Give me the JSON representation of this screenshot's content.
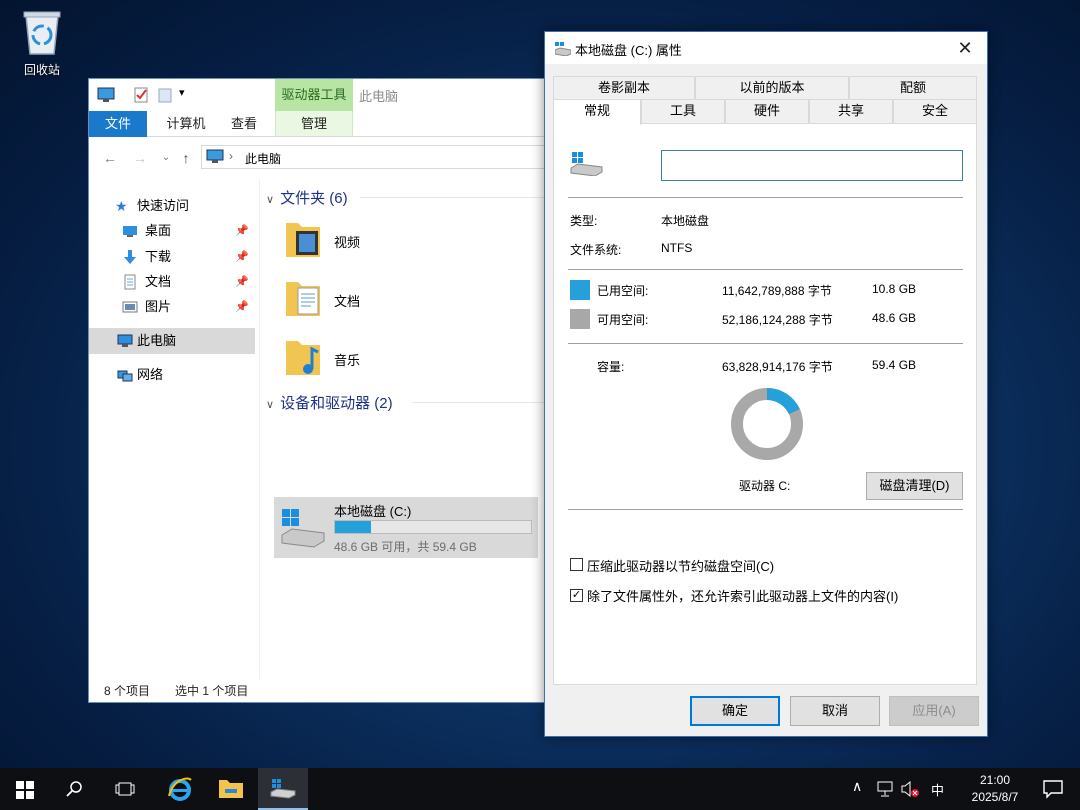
{
  "desktop": {
    "recycle_bin_label": "回收站"
  },
  "explorer": {
    "ribbon": {
      "file": "文件",
      "computer": "计算机",
      "view": "查看",
      "drive_tools": "驱动器工具",
      "manage": "管理",
      "context_title": "此电脑"
    },
    "address": {
      "path": "此电脑"
    },
    "nav": {
      "quick_access": "快速访问",
      "items": [
        {
          "label": "桌面"
        },
        {
          "label": "下载"
        },
        {
          "label": "文档"
        },
        {
          "label": "图片"
        }
      ],
      "this_pc": "此电脑",
      "network": "网络"
    },
    "content": {
      "folders_header": "文件夹 (6)",
      "folders": [
        {
          "label": "视频"
        },
        {
          "label": "文档"
        },
        {
          "label": "音乐"
        }
      ],
      "devices_header": "设备和驱动器 (2)",
      "drive": {
        "name": "本地磁盘 (C:)",
        "free_text": "48.6 GB 可用，共 59.4 GB",
        "used_fraction": 0.182
      }
    },
    "status": {
      "count": "8 个项目",
      "selected": "选中 1 个项目"
    }
  },
  "properties": {
    "title": "本地磁盘 (C:) 属性",
    "tabs_top": [
      "卷影副本",
      "以前的版本",
      "配额"
    ],
    "tabs_bottom": [
      "常规",
      "工具",
      "硬件",
      "共享",
      "安全"
    ],
    "volume_name": "",
    "type_label": "类型:",
    "type_value": "本地磁盘",
    "fs_label": "文件系统:",
    "fs_value": "NTFS",
    "used_label": "已用空间:",
    "used_bytes": "11,642,789,888 字节",
    "used_gb": "10.8 GB",
    "free_label": "可用空间:",
    "free_bytes": "52,186,124,288 字节",
    "free_gb": "48.6 GB",
    "capacity_label": "容量:",
    "capacity_bytes": "63,828,914,176 字节",
    "capacity_gb": "59.4 GB",
    "drive_label": "驱动器 C:",
    "cleanup_button": "磁盘清理(D)",
    "compress_label": "压缩此驱动器以节约磁盘空间(C)",
    "compress_checked": false,
    "index_label": "除了文件属性外，还允许索引此驱动器上文件的内容(I)",
    "index_checked": true,
    "ok": "确定",
    "cancel": "取消",
    "apply": "应用(A)",
    "used_color": "#26a0da",
    "free_color": "#a8a8a8",
    "used_fraction": 0.182
  },
  "taskbar": {
    "ime": "中",
    "time": "21:00",
    "date": "2025/8/7"
  }
}
